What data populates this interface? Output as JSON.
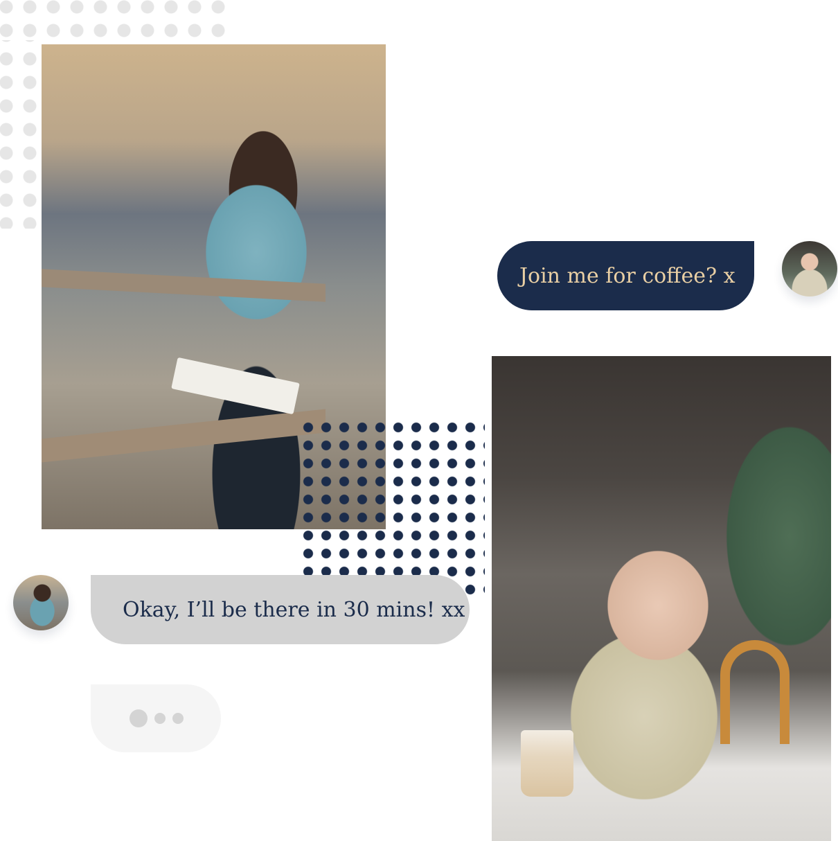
{
  "conversation": {
    "sent_message": "Join me for coffee? x",
    "received_message": "Okay, I’ll be there in 30 mins! xx",
    "typing_indicator": "typing"
  },
  "icons": {
    "typing": "ellipsis-dots-icon"
  },
  "colors": {
    "navy": "#1b2c4b",
    "gold_text": "#e9cfa4",
    "grey_bubble": "#d2d2d2",
    "light_dots": "#e6e6e6"
  }
}
